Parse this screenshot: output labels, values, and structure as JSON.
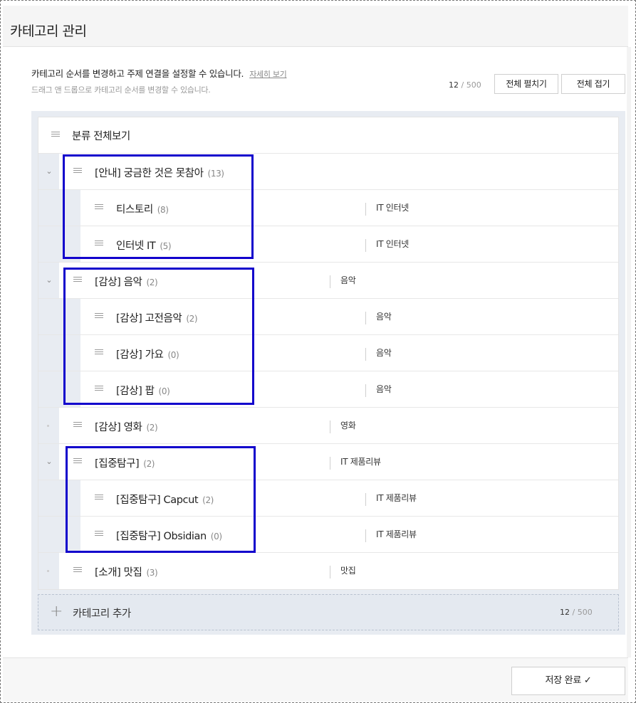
{
  "page": {
    "title": "카테고리 관리"
  },
  "description": {
    "text": "카테고리 순서를 변경하고 주제 연결을 설정할 수 있습니다.",
    "link": "자세히 보기",
    "sub": "드래그 앤 드롭으로 카테고리 순서를 변경할 수 있습니다."
  },
  "counter": {
    "current": "12",
    "max": "/ 500"
  },
  "buttons": {
    "expand_all": "전체 펼치기",
    "collapse_all": "전체 접기",
    "save": "저장 완료"
  },
  "tree": {
    "root": {
      "label": "분류 전체보기"
    },
    "items": [
      {
        "label": "[안내] 궁금한 것은 못참아",
        "count": "(13)",
        "topic": "",
        "toggle": "chevron-down-icon"
      },
      {
        "label": "티스토리",
        "count": "(8)",
        "topic": "IT 인터넷"
      },
      {
        "label": "인터넷 IT",
        "count": "(5)",
        "topic": "IT 인터넷"
      },
      {
        "label": "[감상] 음악",
        "count": "(2)",
        "topic": "음악",
        "toggle": "chevron-down-icon"
      },
      {
        "label": "[감상] 고전음악",
        "count": "(2)",
        "topic": "음악"
      },
      {
        "label": "[감상] 가요",
        "count": "(0)",
        "topic": "음악"
      },
      {
        "label": "[감상] 팝",
        "count": "(0)",
        "topic": "음악"
      },
      {
        "label": "[감상] 영화",
        "count": "(2)",
        "topic": "영화",
        "toggle": "dot-icon"
      },
      {
        "label": "[집중탐구]",
        "count": "(2)",
        "topic": "IT 제품리뷰",
        "toggle": "chevron-down-icon"
      },
      {
        "label": "[집중탐구] Capcut",
        "count": "(2)",
        "topic": "IT 제품리뷰"
      },
      {
        "label": "[집중탐구] Obsidian",
        "count": "(0)",
        "topic": "IT 제품리뷰"
      },
      {
        "label": "[소개] 맛집",
        "count": "(3)",
        "topic": "맛집",
        "toggle": "dot-icon"
      }
    ]
  },
  "add_category": {
    "label": "카테고리 추가",
    "current": "12",
    "max": "/ 500"
  },
  "colors": {
    "highlight": "#1200cc",
    "tree_bg": "#e8ecf2"
  }
}
